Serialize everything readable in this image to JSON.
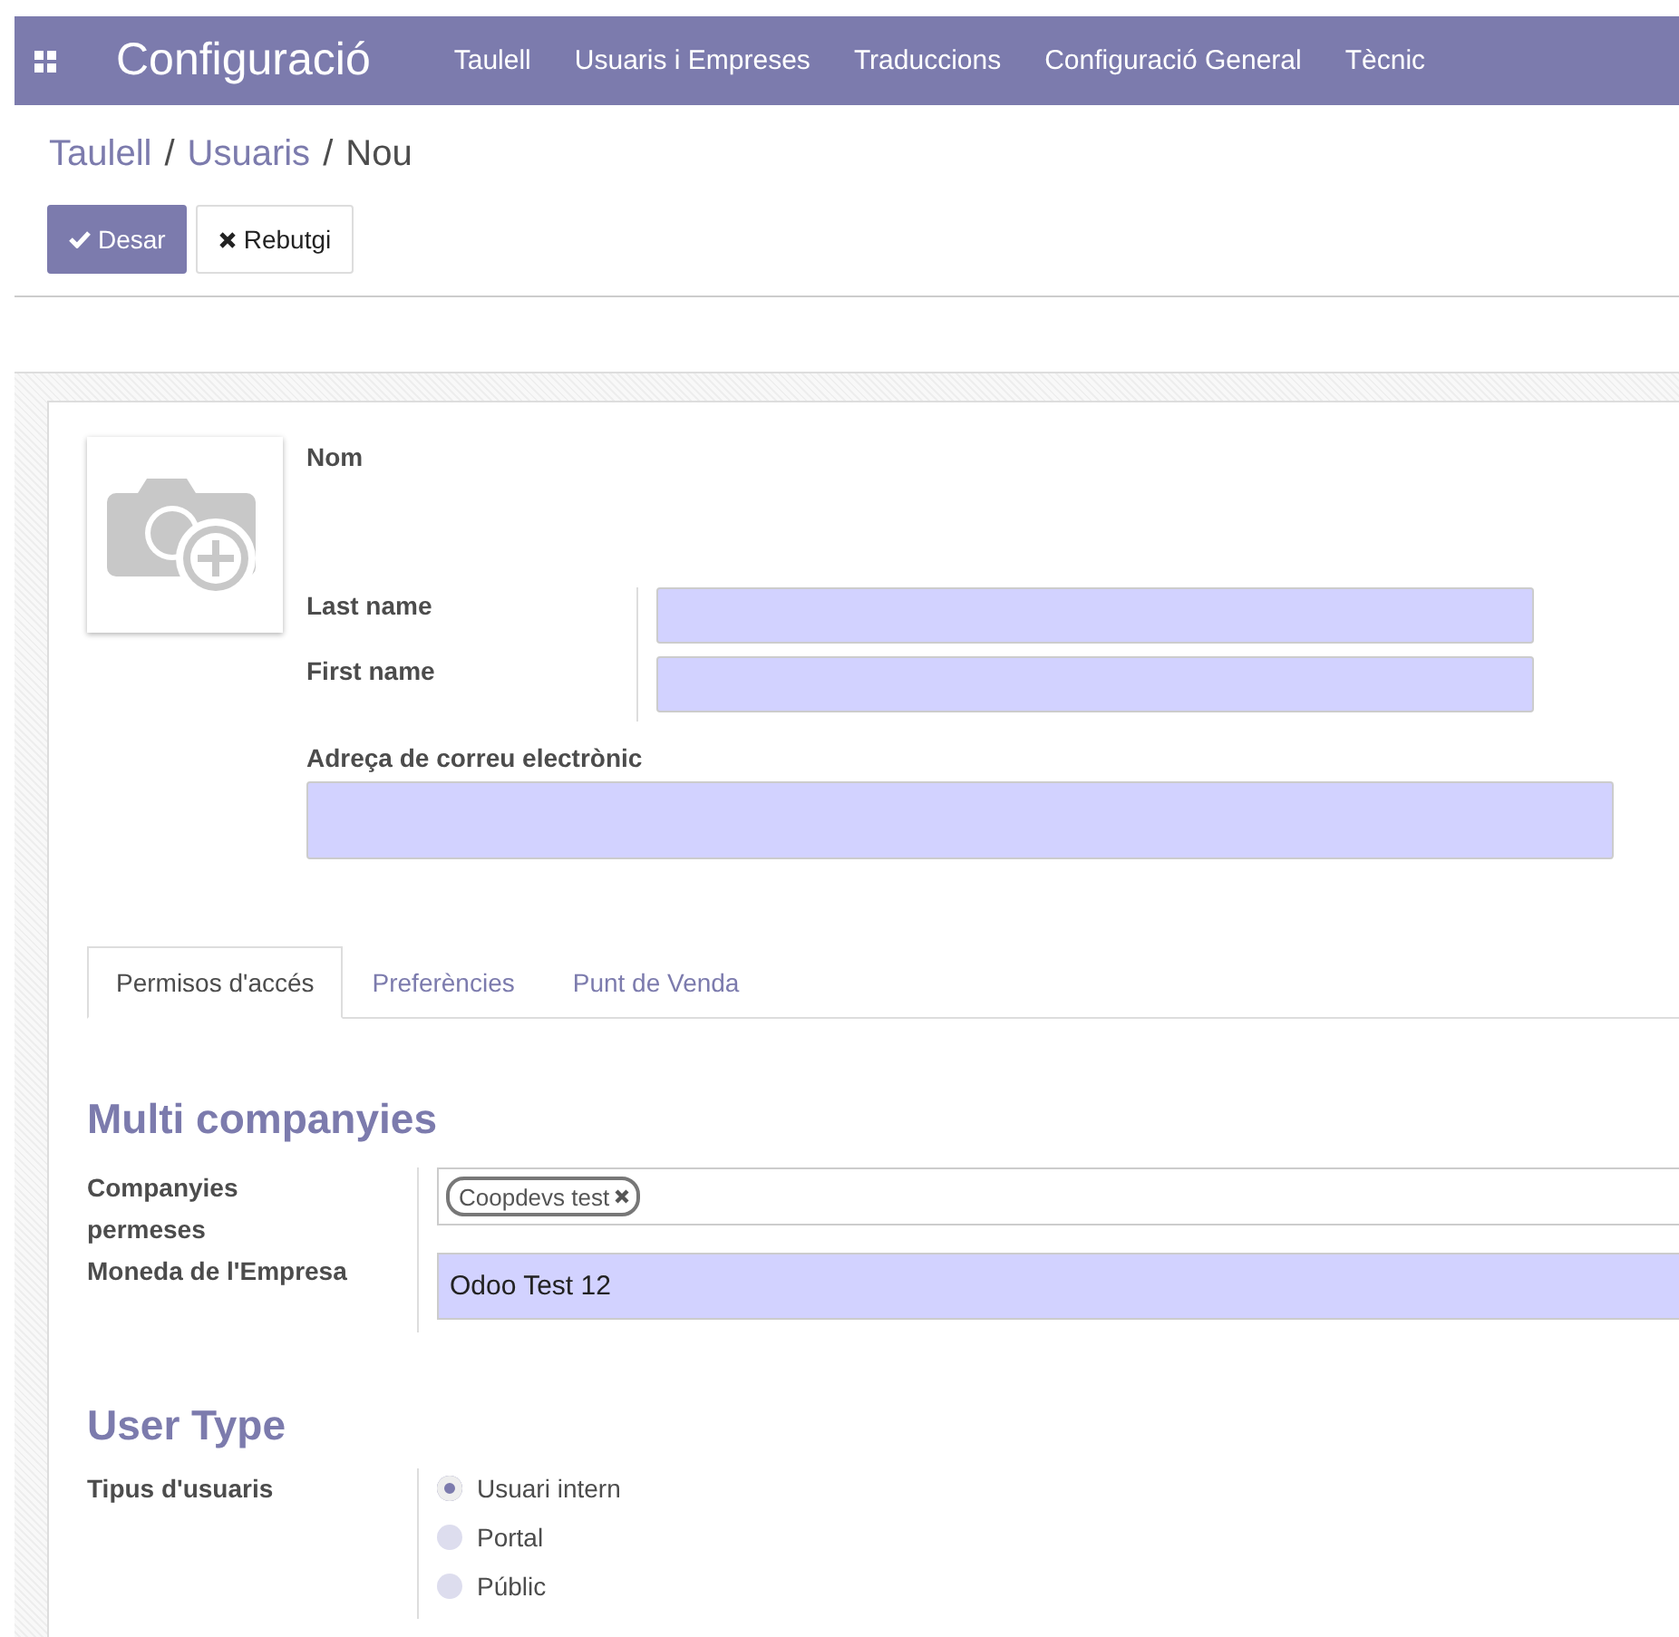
{
  "navbar": {
    "app_title": "Configuració",
    "menu": [
      {
        "label": "Taulell"
      },
      {
        "label": "Usuaris i Empreses"
      },
      {
        "label": "Traduccions"
      },
      {
        "label": "Configuració General"
      },
      {
        "label": "Tècnic"
      }
    ]
  },
  "breadcrumb": {
    "links": [
      "Taulell",
      "Usuaris"
    ],
    "separators": [
      "/",
      "/"
    ],
    "current": "Nou"
  },
  "buttons": [
    {
      "kind": "primary",
      "label": "Desar"
    },
    {
      "kind": "secondary",
      "label": "Rebutgi"
    }
  ],
  "form": {
    "name_label": "Nom",
    "name_fields": [
      {
        "label": "Last name"
      },
      {
        "label": "First name"
      }
    ],
    "email": {
      "label": "Adreça de correu electrònic"
    }
  },
  "tabs": [
    {
      "label": "Permisos d'accés",
      "selected": true
    },
    {
      "label": "Preferències",
      "selected": false
    },
    {
      "label": "Punt de Venda",
      "selected": false
    }
  ],
  "multi_companies": {
    "title": "Multi companyies",
    "companies": {
      "label": "Companyies permeses",
      "tags": [
        "Coopdevs test"
      ]
    },
    "currency": {
      "label": "Moneda de l'Empresa",
      "value": "Odoo Test 12"
    }
  },
  "user_type": {
    "title": "User Type",
    "label": "Tipus d'usuaris",
    "options": [
      {
        "label": "Usuari intern",
        "selected": true
      },
      {
        "label": "Portal",
        "selected": false
      },
      {
        "label": "Públic",
        "selected": false
      }
    ]
  }
}
